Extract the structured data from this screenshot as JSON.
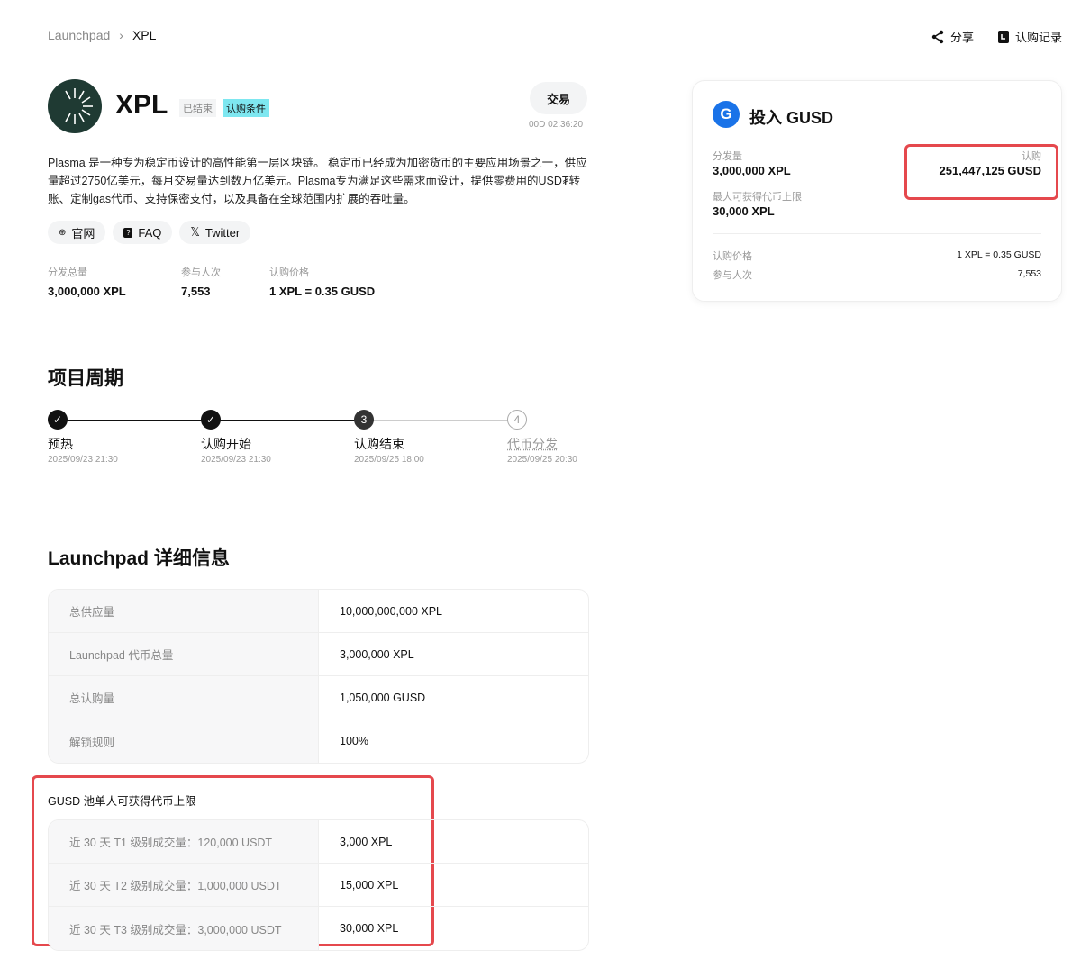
{
  "breadcrumb": {
    "root": "Launchpad",
    "current": "XPL"
  },
  "top_actions": {
    "share": "分享",
    "records": "认购记录"
  },
  "project": {
    "name": "XPL",
    "status": "已结束",
    "conditions": "认购条件",
    "trade": "交易",
    "countdown": "00D 02:36:20",
    "description": "Plasma 是一种专为稳定币设计的高性能第一层区块链。 稳定币已经成为加密货币的主要应用场景之一，供应量超过2750亿美元，每月交易量达到数万亿美元。Plasma专为满足这些需求而设计，提供零费用的USD₮转账、定制gas代币、支持保密支付，以及具备在全球范围内扩展的吞吐量。",
    "links": [
      "官网",
      "FAQ",
      "Twitter"
    ],
    "stats": [
      {
        "label": "分发总量",
        "value": "3,000,000 XPL"
      },
      {
        "label": "参与人次",
        "value": "7,553"
      },
      {
        "label": "认购价格",
        "value": "1 XPL = 0.35 GUSD"
      }
    ]
  },
  "card": {
    "title": "投入 GUSD",
    "dist_label": "分发量",
    "dist_value": "3,000,000 XPL",
    "max_label": "最大可获得代币上限",
    "max_value": "30,000 XPL",
    "sub_label": "认购",
    "sub_value": "251,447,125 GUSD",
    "price_label": "认购价格",
    "price_value": "1 XPL = 0.35 GUSD",
    "part_label": "参与人次",
    "part_value": "7,553"
  },
  "timeline": {
    "title": "项目周期",
    "steps": [
      {
        "name": "预热",
        "date": "2025/09/23 21:30",
        "state": "done"
      },
      {
        "name": "认购开始",
        "date": "2025/09/23 21:30",
        "state": "done"
      },
      {
        "name": "认购结束",
        "date": "2025/09/25 18:00",
        "state": "current",
        "num": "3"
      },
      {
        "name": "代币分发",
        "date": "2025/09/25 20:30",
        "state": "pending",
        "num": "4"
      }
    ]
  },
  "details": {
    "title": "Launchpad 详细信息",
    "rows": [
      [
        "总供应量",
        "10,000,000,000 XPL"
      ],
      [
        "Launchpad 代币总量",
        "3,000,000 XPL"
      ],
      [
        "总认购量",
        "1,050,000 GUSD"
      ],
      [
        "解锁规则",
        "100%"
      ]
    ]
  },
  "pool": {
    "title": "GUSD 池单人可获得代币上限",
    "rows": [
      [
        "近 30 天 T1 级别成交量：120,000 USDT",
        "3,000 XPL"
      ],
      [
        "近 30 天 T2 级别成交量：1,000,000 USDT",
        "15,000 XPL"
      ],
      [
        "近 30 天 T3 级别成交量：3,000,000 USDT",
        "30,000 XPL"
      ]
    ]
  }
}
